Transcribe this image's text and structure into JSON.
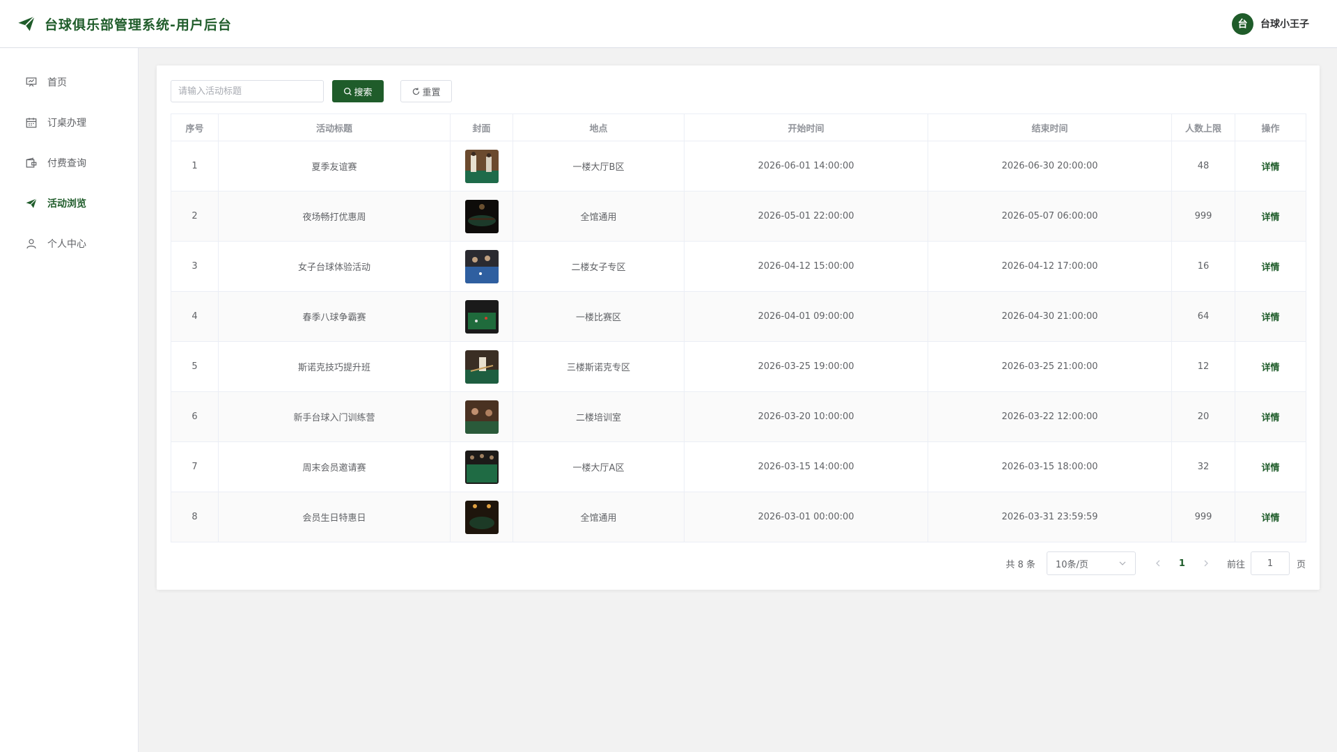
{
  "app": {
    "title": "台球俱乐部管理系统-用户后台"
  },
  "user": {
    "avatar_text": "台",
    "name": "台球小王子"
  },
  "colors": {
    "brand": "#1f5c2a"
  },
  "sidebar": {
    "items": [
      {
        "label": "首页",
        "icon": "presentation-board-icon",
        "active": false
      },
      {
        "label": "订桌办理",
        "icon": "calendar-icon",
        "active": false
      },
      {
        "label": "付费查询",
        "icon": "wallet-icon",
        "active": false
      },
      {
        "label": "活动浏览",
        "icon": "paper-plane-icon",
        "active": true
      },
      {
        "label": "个人中心",
        "icon": "user-icon",
        "active": false
      }
    ]
  },
  "search": {
    "placeholder": "请输入活动标题",
    "search_label": "搜索",
    "reset_label": "重置"
  },
  "table": {
    "headers": [
      "序号",
      "活动标题",
      "封面",
      "地点",
      "开始时间",
      "结束时间",
      "人数上限",
      "操作"
    ],
    "rows": [
      {
        "no": "1",
        "title": "夏季友谊赛",
        "location": "一楼大厅B区",
        "start": "2026-06-01 14:00:00",
        "end": "2026-06-30 20:00:00",
        "limit": "48",
        "action": "详情"
      },
      {
        "no": "2",
        "title": "夜场畅打优惠周",
        "location": "全馆通用",
        "start": "2026-05-01 22:00:00",
        "end": "2026-05-07 06:00:00",
        "limit": "999",
        "action": "详情"
      },
      {
        "no": "3",
        "title": "女子台球体验活动",
        "location": "二楼女子专区",
        "start": "2026-04-12 15:00:00",
        "end": "2026-04-12 17:00:00",
        "limit": "16",
        "action": "详情"
      },
      {
        "no": "4",
        "title": "春季八球争霸赛",
        "location": "一楼比赛区",
        "start": "2026-04-01 09:00:00",
        "end": "2026-04-30 21:00:00",
        "limit": "64",
        "action": "详情"
      },
      {
        "no": "5",
        "title": "斯诺克技巧提升班",
        "location": "三楼斯诺克专区",
        "start": "2026-03-25 19:00:00",
        "end": "2026-03-25 21:00:00",
        "limit": "12",
        "action": "详情"
      },
      {
        "no": "6",
        "title": "新手台球入门训练营",
        "location": "二楼培训室",
        "start": "2026-03-20 10:00:00",
        "end": "2026-03-22 12:00:00",
        "limit": "20",
        "action": "详情"
      },
      {
        "no": "7",
        "title": "周末会员邀请赛",
        "location": "一楼大厅A区",
        "start": "2026-03-15 14:00:00",
        "end": "2026-03-15 18:00:00",
        "limit": "32",
        "action": "详情"
      },
      {
        "no": "8",
        "title": "会员生日特惠日",
        "location": "全馆通用",
        "start": "2026-03-01 00:00:00",
        "end": "2026-03-31 23:59:59",
        "limit": "999",
        "action": "详情"
      }
    ]
  },
  "pagination": {
    "total_text": "共 8 条",
    "page_size": "10条/页",
    "current_page": "1",
    "goto_label": "前往",
    "goto_value": "1",
    "page_suffix": "页"
  }
}
